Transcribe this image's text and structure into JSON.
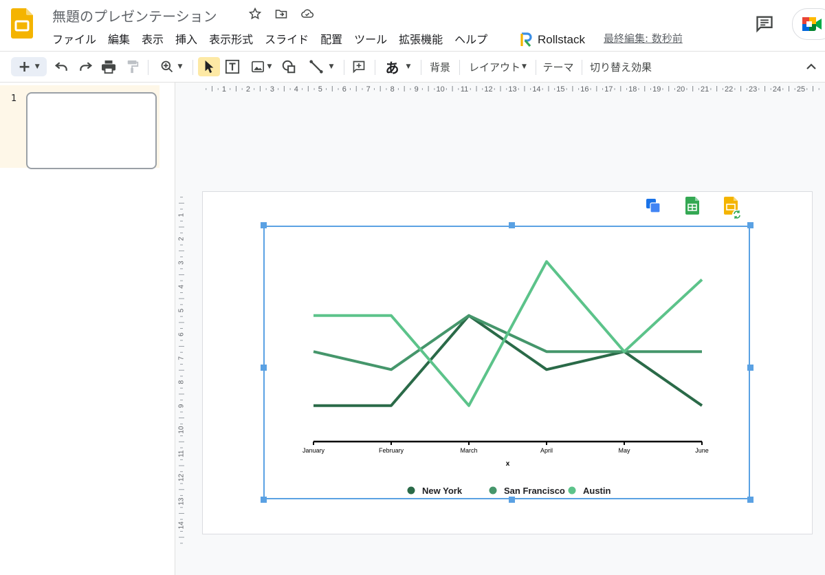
{
  "app": {
    "title": "無題のプレゼンテーション",
    "last_edit": "最終編集: 数秒前",
    "addon_name": "Rollstack",
    "icons": [
      "slides-logo-icon",
      "star-icon",
      "move-folder-icon",
      "cloud-status-icon",
      "comment-icon",
      "meet-icon"
    ]
  },
  "menu": [
    "ファイル",
    "編集",
    "表示",
    "挿入",
    "表示形式",
    "スライド",
    "配置",
    "ツール",
    "拡張機能",
    "ヘルプ"
  ],
  "toolbar": {
    "background": "背景",
    "layout": "レイアウト",
    "theme": "テーマ",
    "transition": "切り替え効果",
    "text_style": "あ"
  },
  "filmstrip": {
    "slides": [
      {
        "number": "1"
      }
    ]
  },
  "rulers": {
    "horizontal": [
      "1",
      "2",
      "3",
      "4",
      "5",
      "6",
      "7",
      "8",
      "9",
      "10",
      "11",
      "12",
      "13",
      "14",
      "15",
      "16",
      "17",
      "18",
      "19",
      "20",
      "21",
      "22",
      "23",
      "24",
      "25"
    ],
    "vertical": [
      "1",
      "2",
      "3",
      "4",
      "5",
      "6",
      "7",
      "8",
      "9",
      "10",
      "11",
      "12",
      "13",
      "14"
    ]
  },
  "colors": {
    "accent": "#5aa1e3",
    "slides_yellow": "#f4b400",
    "sheets_green": "#34a853"
  },
  "chart_data": {
    "type": "line",
    "categories": [
      "January",
      "February",
      "March",
      "April",
      "May",
      "June"
    ],
    "xlabel": "x",
    "ylabel": "",
    "ylim": [
      0,
      12
    ],
    "grid": false,
    "legend_position": "bottom",
    "series": [
      {
        "name": "New York",
        "color": "#2a6a48",
        "values": [
          2,
          2,
          7,
          4,
          5,
          2
        ]
      },
      {
        "name": "San Francisco",
        "color": "#45966b",
        "values": [
          5,
          4,
          7,
          5,
          5,
          5
        ]
      },
      {
        "name": "Austin",
        "color": "#5cc38a",
        "values": [
          7,
          7,
          2,
          10,
          5,
          9
        ]
      }
    ]
  }
}
